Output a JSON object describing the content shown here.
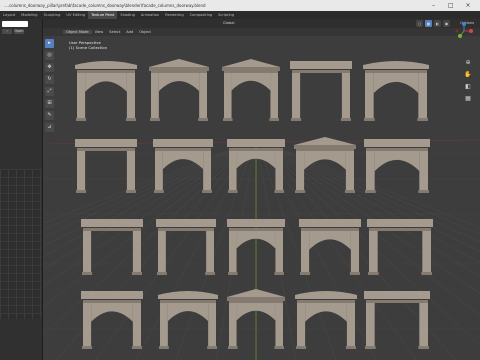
{
  "window": {
    "title": "....columns_doorway_pillar\\prefab\\facade_columns_doorway\\blender\\facade_columns_doorway.blend"
  },
  "workspace_tabs": [
    "Layout",
    "Modeling",
    "Sculpting",
    "UV Editing",
    "Texture Paint",
    "Shading",
    "Animation",
    "Rendering",
    "Compositing",
    "Scripting"
  ],
  "active_tab": "Texture Paint",
  "viewport": {
    "mode_label": "Object Mode",
    "menu": [
      "View",
      "Select",
      "Add",
      "Object"
    ],
    "overlay_lines": [
      "User Perspective",
      "(1) Scene Collection"
    ],
    "pivot_label": "Global",
    "options_label": "Options"
  },
  "left_panel": {
    "new_label": "Open"
  },
  "tools": [
    "select-icon",
    "cursor-icon",
    "move-icon",
    "rotate-icon",
    "scale-icon",
    "transform-icon",
    "annotate-icon",
    "measure-icon"
  ],
  "colors": {
    "stone": "#a59a8e",
    "stone_dark": "#857a6f",
    "accent": "#5680c2",
    "axis_red": "#b03a3a",
    "axis_green": "#6a9a2a"
  }
}
